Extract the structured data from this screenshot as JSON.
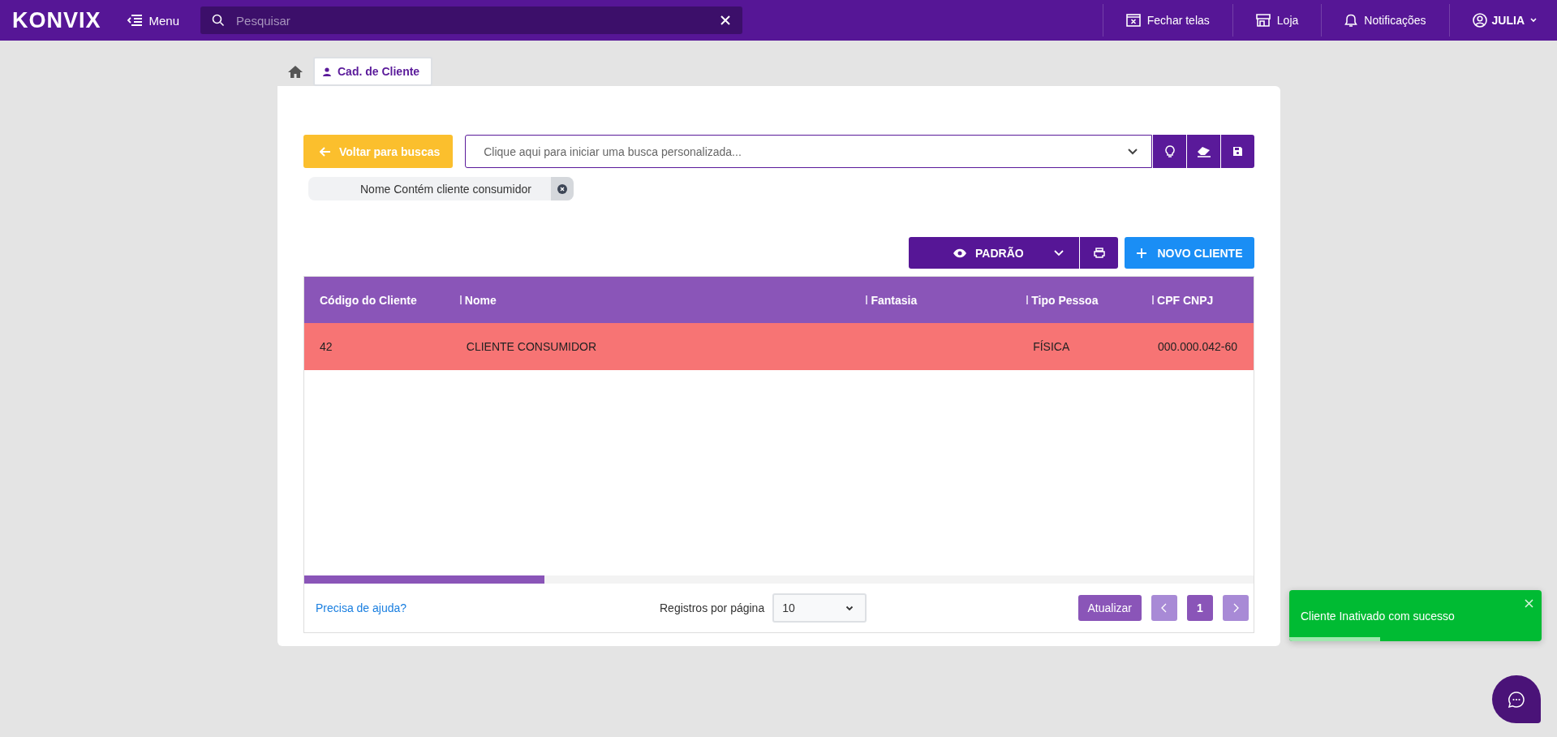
{
  "topbar": {
    "logo": "KONVIX",
    "menu_label": "Menu",
    "search": {
      "placeholder": "Pesquisar"
    },
    "actions": [
      {
        "kind": "close-screens",
        "label": "Fechar telas"
      },
      {
        "kind": "store",
        "label": "Loja"
      },
      {
        "kind": "notifications",
        "label": "Notificações"
      }
    ],
    "user": "JULIA"
  },
  "tabs": [
    {
      "kind": "home",
      "selected": false
    },
    {
      "kind": "page",
      "label": "Cad. de Cliente",
      "selected": true
    }
  ],
  "back_button": "Voltar para buscas",
  "custom_search": {
    "placeholder": "Clique aqui para iniciar uma busca personalizada..."
  },
  "filters": [
    {
      "label": "Nome Contém cliente consumidor"
    }
  ],
  "view_button": "PADRÃO",
  "new_button": "NOVO CLIENTE",
  "table": {
    "columns": [
      "Código do Cliente",
      "Nome",
      "Fantasia",
      "Tipo Pessoa",
      "CPF CNPJ"
    ],
    "rows": [
      {
        "inactive": true,
        "cells": [
          "42",
          "CLIENTE CONSUMIDOR",
          "",
          "FÍSICA",
          "000.000.042-60"
        ]
      }
    ]
  },
  "footer": {
    "help_link": "Precisa de ajuda?",
    "page_size_label": "Registros por página",
    "page_size": "10",
    "refresh": "Atualizar",
    "pages": [
      {
        "label": "1",
        "selected": true
      }
    ]
  },
  "toast": {
    "message": "Cliente Inativado com sucesso",
    "level": 0.36
  }
}
